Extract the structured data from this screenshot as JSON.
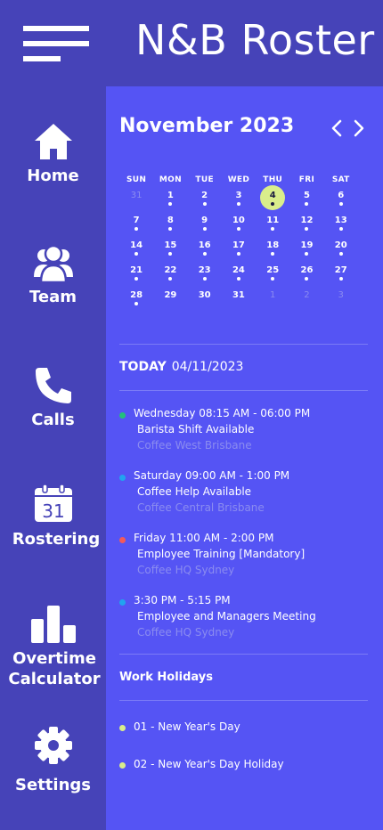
{
  "app": {
    "title": "N&B Roster"
  },
  "sidebar": {
    "items": [
      {
        "label": "Home",
        "icon": "home-icon"
      },
      {
        "label": "Team",
        "icon": "team-icon"
      },
      {
        "label": "Calls",
        "icon": "phone-icon"
      },
      {
        "label": "Rostering",
        "icon": "calendar-icon",
        "badge": "31"
      },
      {
        "label": "Overtime Calculator",
        "icon": "bar-chart-icon"
      },
      {
        "label": "Settings",
        "icon": "gear-icon"
      }
    ]
  },
  "calendar": {
    "month_label": "November 2023",
    "weekdays": [
      "SUN",
      "MON",
      "TUE",
      "WED",
      "THU",
      "FRI",
      "SAT"
    ],
    "weeks": [
      [
        {
          "d": "31",
          "m": true,
          "dot": false
        },
        {
          "d": "1",
          "dot": true
        },
        {
          "d": "2",
          "dot": true
        },
        {
          "d": "3",
          "dot": true
        },
        {
          "d": "4",
          "dot": true,
          "today": true
        },
        {
          "d": "5",
          "dot": true
        },
        {
          "d": "6",
          "dot": true
        }
      ],
      [
        {
          "d": "7",
          "dot": true
        },
        {
          "d": "8",
          "dot": true
        },
        {
          "d": "9",
          "dot": true
        },
        {
          "d": "10",
          "dot": true
        },
        {
          "d": "11",
          "dot": true
        },
        {
          "d": "12",
          "dot": true
        },
        {
          "d": "13",
          "dot": true
        }
      ],
      [
        {
          "d": "14",
          "dot": true
        },
        {
          "d": "15",
          "dot": true
        },
        {
          "d": "16",
          "dot": true
        },
        {
          "d": "17",
          "dot": true
        },
        {
          "d": "18",
          "dot": true
        },
        {
          "d": "19",
          "dot": true
        },
        {
          "d": "20",
          "dot": true
        }
      ],
      [
        {
          "d": "21",
          "dot": true
        },
        {
          "d": "22",
          "dot": true
        },
        {
          "d": "23",
          "dot": true
        },
        {
          "d": "24",
          "dot": true
        },
        {
          "d": "25",
          "dot": true
        },
        {
          "d": "26",
          "dot": true
        },
        {
          "d": "27",
          "dot": true
        }
      ],
      [
        {
          "d": "28",
          "dot": true
        },
        {
          "d": "29",
          "dot": false
        },
        {
          "d": "30",
          "dot": false
        },
        {
          "d": "31",
          "dot": false
        },
        {
          "d": "1",
          "m": true,
          "dot": false
        },
        {
          "d": "2",
          "m": true,
          "dot": false
        },
        {
          "d": "3",
          "m": true,
          "dot": false
        }
      ]
    ]
  },
  "today": {
    "label": "TODAY",
    "date": "04/11/2023"
  },
  "events": [
    {
      "when": "Wednesday 08:15 AM - 06:00 PM",
      "what": "Barista Shift Available",
      "where": "Coffee West Brisbane",
      "color": "#22c07a"
    },
    {
      "when": "Saturday 09:00  AM - 1:00 PM",
      "what": "Coffee Help Available",
      "where": "Coffee Central Brisbane",
      "color": "#21a4ef"
    },
    {
      "when": "Friday 11:00 AM - 2:00 PM",
      "what": "Employee Training [Mandatory]",
      "where": "Coffee HQ Sydney",
      "color": "#f25a5a"
    },
    {
      "when": "3:30 PM - 5:15 PM",
      "what": "Employee and Managers Meeting",
      "where": "Coffee HQ Sydney",
      "color": "#21a4ef"
    }
  ],
  "holidays": {
    "title": "Work Holidays",
    "items": [
      "01 - New Year's Day",
      "02 - New Year's Day Holiday"
    ]
  },
  "colors": {
    "sidebar": "#4643b8",
    "panel": "#5554f4",
    "today_highlight": "#d9ed8b"
  }
}
